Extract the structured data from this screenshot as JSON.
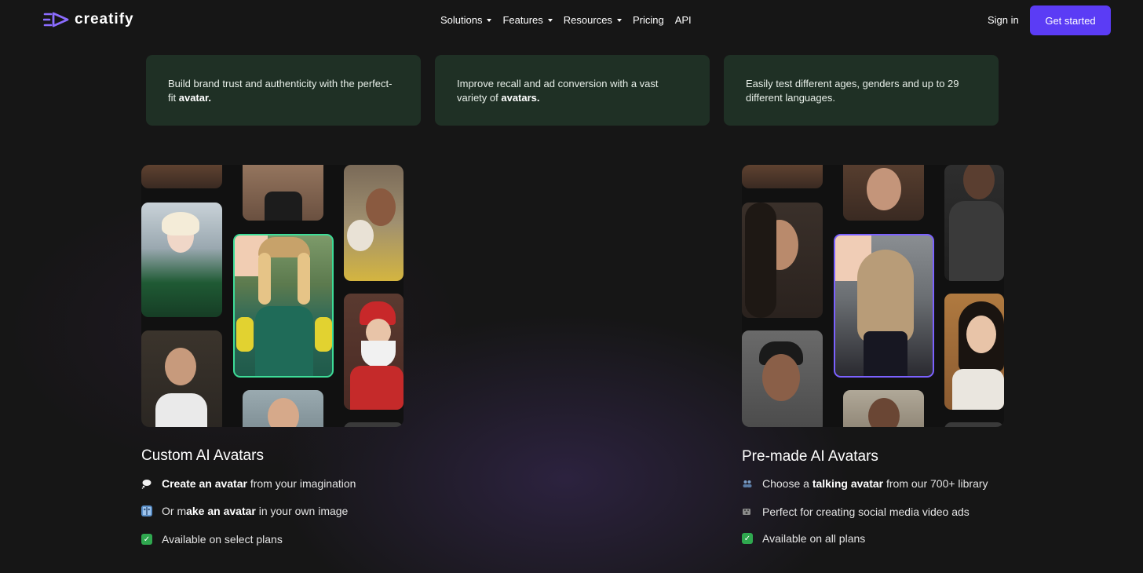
{
  "nav": {
    "brand": "creatify",
    "menu": [
      {
        "label": "Solutions",
        "dropdown": true
      },
      {
        "label": "Features",
        "dropdown": true
      },
      {
        "label": "Resources",
        "dropdown": true
      },
      {
        "label": "Pricing",
        "dropdown": false
      },
      {
        "label": "API",
        "dropdown": false
      }
    ],
    "sign_in": "Sign in",
    "get_started": "Get started",
    "accent_color": "#5b3cf5"
  },
  "benefits": [
    {
      "prefix": "Build brand trust and authenticity with the perfect-fit ",
      "bold": "avatar."
    },
    {
      "prefix": "Improve recall and ad conversion with a vast variety of ",
      "bold": "avatars."
    },
    {
      "prefix": "Easily test different ages, genders and up to 29 different languages.",
      "bold": ""
    }
  ],
  "custom": {
    "title": "Custom AI Avatars",
    "bullets": [
      {
        "icon": "thought-bubble-icon",
        "bold": "Create an avatar",
        "text": " from your imagination"
      },
      {
        "icon": "person-mirror-icon",
        "pre": "Or m",
        "bold": "ake an avatar",
        "text": " in your own image"
      },
      {
        "icon": "check-icon",
        "text": "Available on select plans"
      }
    ],
    "highlight_color": "#3ddc97"
  },
  "premade": {
    "title": "Pre-made AI Avatars",
    "bullets": [
      {
        "icon": "people-icon",
        "pre": "Choose a ",
        "bold": "talking avatar",
        "text": " from our 700+ library"
      },
      {
        "icon": "film-icon",
        "text": "Perfect for creating social media video ads"
      },
      {
        "icon": "check-icon",
        "text": "Available on all plans"
      }
    ],
    "highlight_color": "#7b61ff"
  }
}
